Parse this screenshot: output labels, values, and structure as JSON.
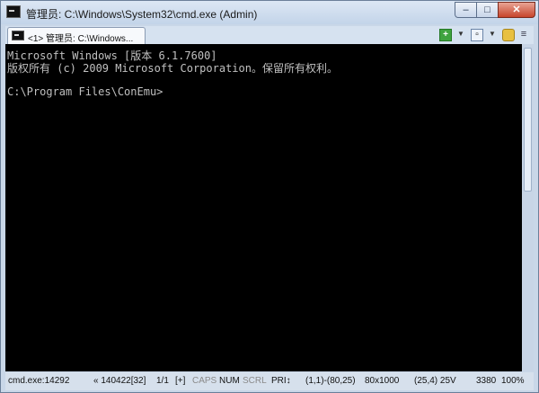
{
  "window": {
    "title": "管理员: C:\\Windows\\System32\\cmd.exe (Admin)",
    "controls": {
      "minimize": "–",
      "maximize": "□",
      "close": "✕"
    }
  },
  "tabs": [
    {
      "label": "<1> 管理员: C:\\Windows..."
    }
  ],
  "toolbar": {
    "add": "+",
    "add_arrow": "▼",
    "split": "▫",
    "split_arrow": "▼",
    "lock": "🔒",
    "menu": "≡"
  },
  "console": {
    "lines": [
      "Microsoft Windows [版本 6.1.7600]",
      "版权所有 (c) 2009 Microsoft Corporation。保留所有权利。",
      "",
      "C:\\Program Files\\ConEmu>"
    ]
  },
  "status": {
    "process": "cmd.exe:14292",
    "pid_info": "« 140422[32]",
    "console_index": "1/1",
    "plus": "[+]",
    "caps": "CAPS",
    "num": "NUM",
    "scrl": "SCRL",
    "priority": "PRI↕",
    "selection": "(1,1)-(80,25)",
    "buffer": "80x1000",
    "cursor": "(25,4) 25V",
    "value": "3380",
    "zoom": "100%"
  }
}
